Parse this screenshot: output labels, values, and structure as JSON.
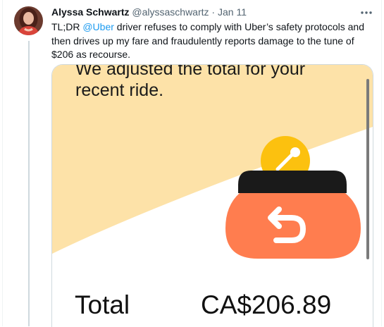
{
  "tweet": {
    "display_name": "Alyssa Schwartz",
    "handle": "@alyssaschwartz",
    "separator": "·",
    "date": "Jan 11",
    "text_before_mention": "TL;DR ",
    "mention": "@Uber",
    "text_after_mention": " driver refuses to comply with Uber’s safety protocols and then drives up my fare and fraudulently reports damage to the tune of $206 as recourse."
  },
  "icons": {
    "more": "more-horizontal-icon",
    "refund": "coin-wallet-refund-icon"
  },
  "media": {
    "heading_partial": "We adjusted the total for your",
    "heading_line2": "recent ride.",
    "total_label": "Total",
    "total_value": "CA$206.89"
  },
  "colors": {
    "banner_bg": "#fde2a8",
    "wallet": "#ff7d4f",
    "coin": "#fcc10f",
    "mention": "#1d9bf0"
  }
}
